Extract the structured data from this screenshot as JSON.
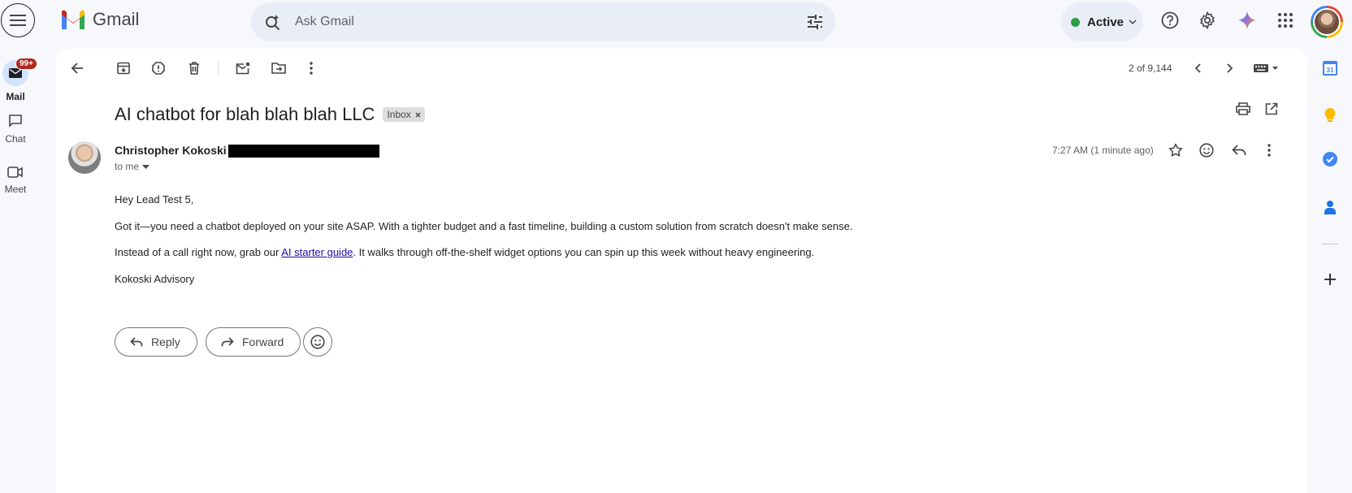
{
  "app": {
    "name": "Gmail"
  },
  "search": {
    "placeholder": "Ask Gmail"
  },
  "status": {
    "label": "Active",
    "color": "#2e9b46"
  },
  "rail": {
    "items": [
      {
        "label": "Mail",
        "badge": "99+",
        "icon": "mail-icon"
      },
      {
        "label": "Chat",
        "icon": "chat-icon"
      },
      {
        "label": "Meet",
        "icon": "video-icon"
      }
    ]
  },
  "toolbar": {
    "pager": "2 of 9,144"
  },
  "email": {
    "subject": "AI chatbot for blah blah blah LLC",
    "label_chip": "Inbox",
    "sender_name": "Christopher Kokoski",
    "recipient": "to me",
    "time": "7:27 AM (1 minute ago)",
    "greeting": "Hey Lead Test 5,",
    "paragraph1": "Got it—you need a chatbot deployed on your site ASAP. With a tighter budget and a fast timeline, building a custom solution from scratch doesn't make sense.",
    "paragraph2_before": "Instead of a call right now, grab our ",
    "paragraph2_link": "AI starter guide",
    "paragraph2_after": ". It walks through off-the-shelf widget options you can spin up this week without heavy engineering.",
    "signature": "Kokoski Advisory"
  },
  "actions": {
    "reply": "Reply",
    "forward": "Forward"
  },
  "colors": {
    "accent": "#0b57d0",
    "badge": "#b3261e",
    "link": "#1a0dab"
  }
}
